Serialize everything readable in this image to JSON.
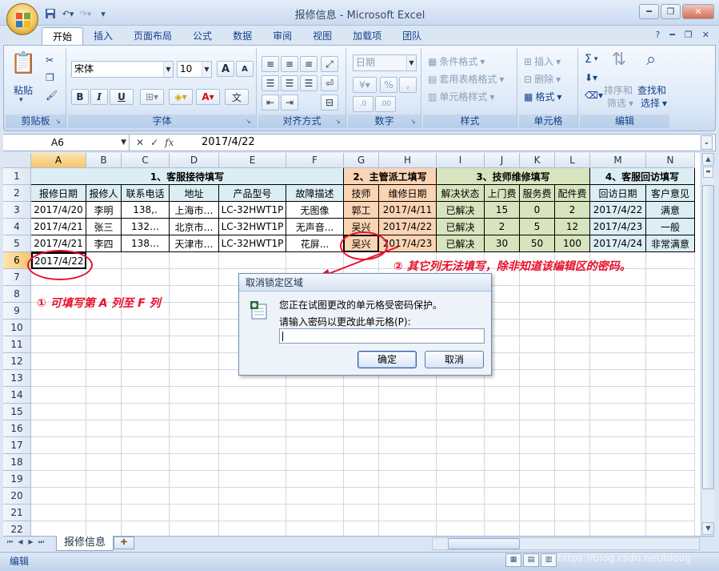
{
  "window": {
    "title": "报修信息 - Microsoft Excel"
  },
  "tabs": [
    "开始",
    "插入",
    "页面布局",
    "公式",
    "数据",
    "审阅",
    "视图",
    "加载项",
    "团队"
  ],
  "ribbon": {
    "clipboard": {
      "label": "剪贴板",
      "paste": "粘贴"
    },
    "font": {
      "label": "字体",
      "name": "宋体",
      "size": "10",
      "bold": "B",
      "italic": "I",
      "underline": "U",
      "grow": "A",
      "shrink": "A",
      "wen": "文"
    },
    "alignment": {
      "label": "对齐方式"
    },
    "number": {
      "label": "数字",
      "format": "日期",
      "percent": "%",
      "comma": ","
    },
    "styles": {
      "label": "样式",
      "cond": "条件格式",
      "table": "套用表格格式",
      "cell": "单元格样式"
    },
    "cells": {
      "label": "单元格",
      "insert": "插入",
      "delete": "删除",
      "format": "格式"
    },
    "editing": {
      "label": "编辑",
      "sigma": "Σ",
      "sort1": "排序和",
      "sort2": "筛选",
      "find1": "查找和",
      "find2": "选择"
    }
  },
  "formula_bar": {
    "name_box": "A6",
    "fx": "fx",
    "value": "2017/4/22"
  },
  "grid": {
    "columns": [
      "A",
      "B",
      "C",
      "D",
      "E",
      "F",
      "G",
      "H",
      "I",
      "J",
      "K",
      "L",
      "M",
      "N"
    ],
    "rows": [
      "1",
      "2",
      "3",
      "4",
      "5",
      "6",
      "7",
      "8",
      "9",
      "10",
      "11",
      "12",
      "13",
      "14",
      "15",
      "16",
      "17",
      "18",
      "19",
      "20",
      "21",
      "22"
    ],
    "groups": [
      "1、客服接待填写",
      "2、主管派工填写",
      "3、技师维修填写",
      "4、客服回访填写"
    ],
    "headers": [
      "报修日期",
      "报修人",
      "联系电话",
      "地址",
      "产品型号",
      "故障描述",
      "技师",
      "维修日期",
      "解决状态",
      "上门费",
      "服务费",
      "配件费",
      "回访日期",
      "客户意见"
    ],
    "data": [
      [
        "2017/4/20",
        "李明",
        "138,.",
        "上海市…",
        "LC-32HWT1P",
        "无图像",
        "郭工",
        "2017/4/11",
        "已解决",
        "15",
        "0",
        "2",
        "2017/4/22",
        "满意"
      ],
      [
        "2017/4/21",
        "张三",
        "132…",
        "北京市…",
        "LC-32HWT1P",
        "无声音...",
        "吴兴",
        "2017/4/22",
        "已解决",
        "2",
        "5",
        "12",
        "2017/4/23",
        "一般"
      ],
      [
        "2017/4/21",
        "李四",
        "138…",
        "天津市…",
        "LC-32HWT1P",
        "花屏...",
        "吴兴",
        "2017/4/23",
        "已解决",
        "30",
        "50",
        "100",
        "2017/4/24",
        "非常满意"
      ]
    ],
    "a6": "2017/4/22"
  },
  "annotations": {
    "left": "① 可填写第 A 列至 F 列",
    "right": "② 其它列无法填写，除非知道该编辑区的密码。"
  },
  "dialog": {
    "title": "取消锁定区域",
    "message": "您正在试图更改的单元格受密码保护。",
    "prompt": "请输入密码以更改此单元格(P):",
    "ok": "确定",
    "cancel": "取消"
  },
  "sheet_tab": "报修信息",
  "status": {
    "mode": "编辑",
    "watermark": "https://blog.csdn.net/bloug"
  },
  "colors": {
    "group1": "#dbeef4",
    "group2": "#fbd4b4",
    "group3": "#d7e4bd",
    "annotation": "#e8102a"
  }
}
